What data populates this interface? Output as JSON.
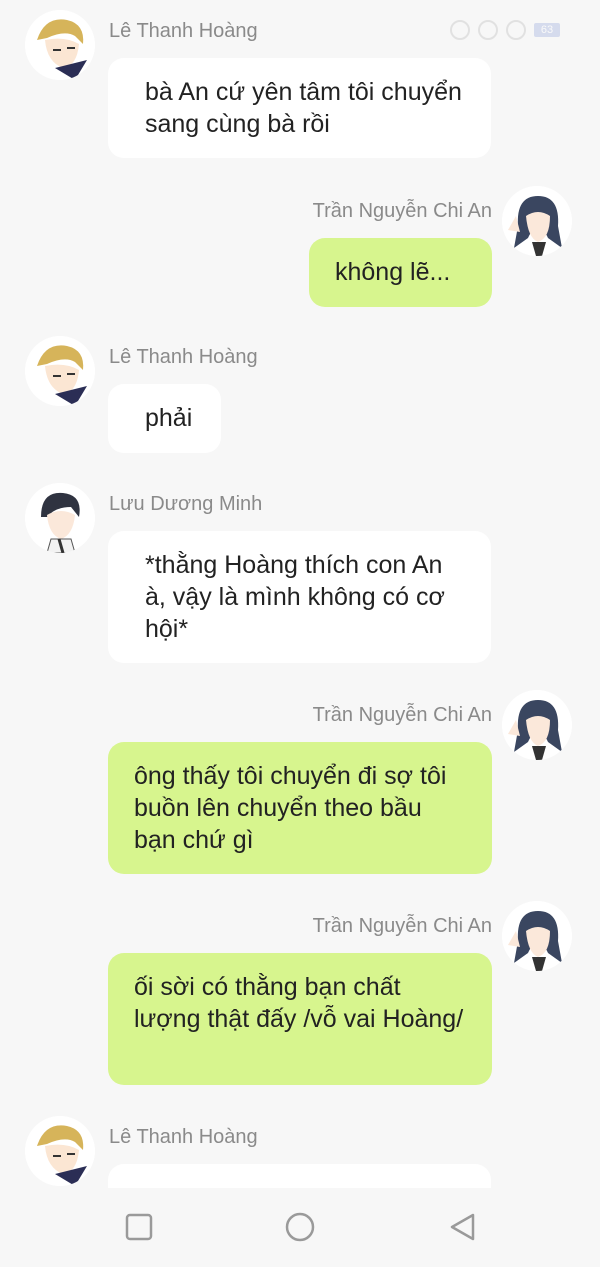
{
  "status_bar": {
    "battery": "63"
  },
  "messages": [
    {
      "sender": "Lê Thanh Hoàng",
      "side": "left",
      "avatar": "blond-boy-avatar",
      "text": "bà An cứ yên tâm tôi chuyển sang cùng bà rồi"
    },
    {
      "sender": "Trần Nguyễn Chi An",
      "side": "right",
      "avatar": "dark-hair-girl-avatar",
      "text": "không lẽ..."
    },
    {
      "sender": "Lê Thanh Hoàng",
      "side": "left",
      "avatar": "blond-boy-avatar",
      "text": "phải"
    },
    {
      "sender": "Lưu Dương Minh",
      "side": "left",
      "avatar": "dark-hair-boy-avatar",
      "text": "*thằng Hoàng thích con An à, vậy là mình không có cơ hội*"
    },
    {
      "sender": "Trần Nguyễn Chi An",
      "side": "right",
      "avatar": "dark-hair-girl-avatar",
      "text": "ông thấy tôi chuyển đi sợ tôi buồn lên chuyển theo bầu bạn chứ gì"
    },
    {
      "sender": "Trần Nguyễn Chi An",
      "side": "right",
      "avatar": "dark-hair-girl-avatar",
      "text": "ối sời có thằng bạn chất lượng thật đấy /vỗ vai Hoàng/"
    },
    {
      "sender": "Lê Thanh Hoàng",
      "side": "left",
      "avatar": "blond-boy-avatar",
      "text": ""
    }
  ],
  "navbar": {
    "items": [
      "recent-apps",
      "home",
      "back"
    ]
  }
}
